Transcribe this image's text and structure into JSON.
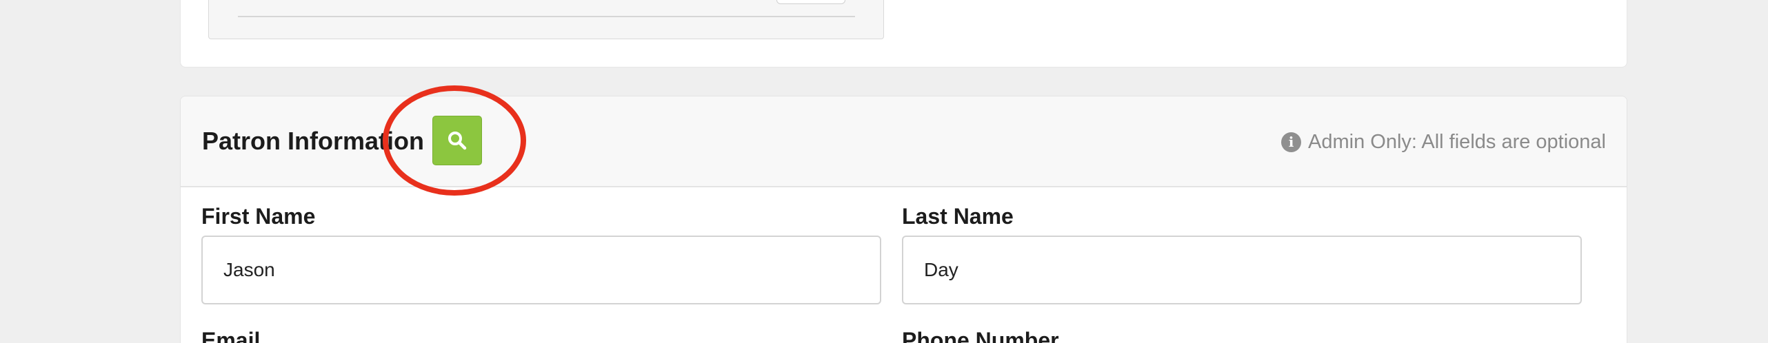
{
  "patron_section": {
    "title": "Patron Information",
    "search_icon": "search-icon",
    "admin_note": "Admin Only: All fields are optional",
    "info_icon": "info-circle-icon",
    "info_glyph": "i"
  },
  "fields": {
    "first_name": {
      "label": "First Name",
      "value": "Jason"
    },
    "last_name": {
      "label": "Last Name",
      "value": "Day"
    },
    "email": {
      "label": "Email"
    },
    "phone": {
      "label": "Phone Number"
    }
  },
  "colors": {
    "search_button": "#8cc63f",
    "annotation_ring": "#e8301c",
    "page_background": "#efefef"
  }
}
